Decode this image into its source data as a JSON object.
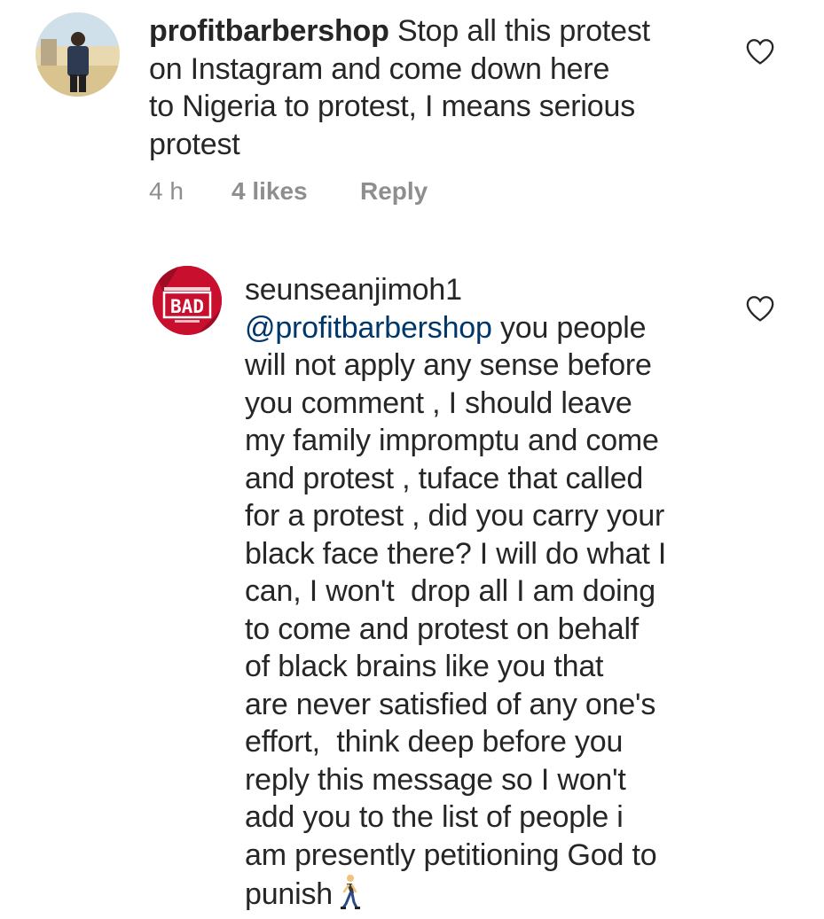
{
  "comments": [
    {
      "username": "profitbarbershop",
      "text": " Stop all this protest on Instagram and come down here to Nigeria to protest, I means serious protest",
      "lines": [
        {
          "username": "profitbarbershop",
          "text": " Stop all this protest"
        },
        {
          "text": "on Instagram and come down here"
        },
        {
          "text": "to Nigeria to protest, I means serious"
        },
        {
          "text": "protest"
        }
      ],
      "time": "4 h",
      "likes": "4 likes",
      "reply_label": "Reply",
      "avatar_icon": "user-photo-avatar",
      "like_icon": "heart-outline-icon"
    },
    {
      "username": "seunseanjimoh1",
      "mention": "@profitbarbershop",
      "lines": [
        {
          "mention": "@profitbarbershop",
          "text": " you people"
        },
        {
          "text": "will not apply any sense before"
        },
        {
          "text": "you comment , I should leave"
        },
        {
          "text": "my family impromptu and come"
        },
        {
          "text": "and protest , tuface that called"
        },
        {
          "text": "for a protest , did you carry your"
        },
        {
          "text": "black face there? I will do what I"
        },
        {
          "text": "can, I won't  drop all I am doing"
        },
        {
          "text": "to come and protest on behalf"
        },
        {
          "text": "of black brains like you that"
        },
        {
          "text": "are never satisfied of any one's"
        },
        {
          "text": "effort,  think deep before you"
        },
        {
          "text": "reply this message so I won't"
        },
        {
          "text": "add you to the list of people i"
        },
        {
          "text": "am presently petitioning God to"
        },
        {
          "text": "punish"
        }
      ],
      "avatar_logo_text": "BAD",
      "trailing_emoji": "person-walking-emoji",
      "like_icon": "heart-outline-icon"
    }
  ],
  "colors": {
    "text": "#262626",
    "muted": "#8e8e8e",
    "mention": "#00376b",
    "avatar_red": "#c8102e"
  }
}
